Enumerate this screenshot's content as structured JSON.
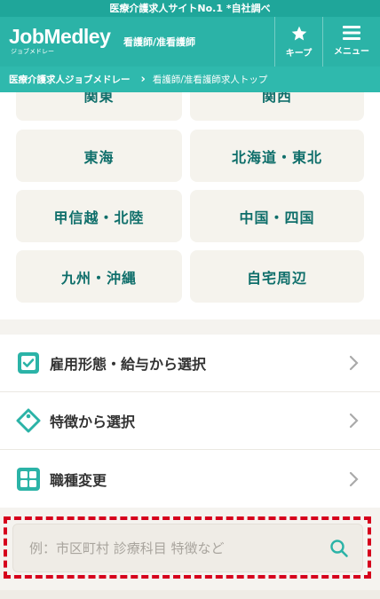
{
  "top_banner": "医療介護求人サイトNo.1 *自社調べ",
  "header": {
    "logo_main": "JobMedley",
    "logo_sub": "ジョブメドレー",
    "subtitle": "看護師/准看護師",
    "keep_label": "キープ",
    "menu_label": "メニュー"
  },
  "breadcrumb": {
    "home": "医療介護求人ジョブメドレー",
    "current": "看護師/准看護師求人トップ"
  },
  "regions": [
    "関東",
    "関西",
    "東海",
    "北海道・東北",
    "甲信越・北陸",
    "中国・四国",
    "九州・沖縄",
    "自宅周辺"
  ],
  "options": [
    {
      "label": "雇用形態・給与から選択",
      "icon": "checkbox-icon"
    },
    {
      "label": "特徴から選択",
      "icon": "tag-icon"
    },
    {
      "label": "職種変更",
      "icon": "grid-icon"
    }
  ],
  "search": {
    "placeholder": "例：市区町村 診療科目 特徴など",
    "value": ""
  },
  "colors": {
    "brand": "#2bb3a7",
    "banner": "#1fa69a",
    "region_text": "#0e6e6a",
    "highlight_dash": "#d6001c"
  }
}
